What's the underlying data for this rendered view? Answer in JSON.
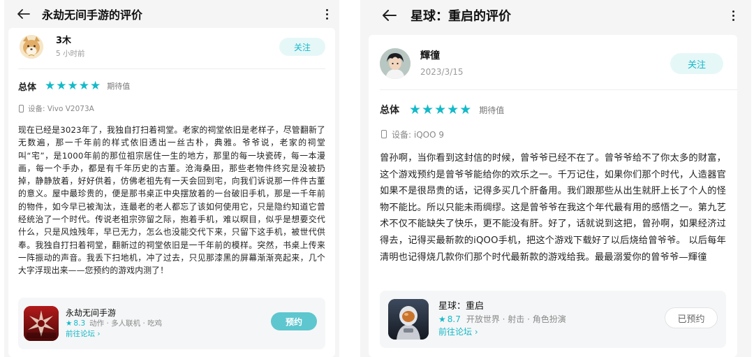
{
  "accent_color": "#14b9c8",
  "left": {
    "title": "永劫无间手游的评价",
    "user": {
      "name": "3木",
      "time": "5 小时前"
    },
    "follow_label": "关注",
    "rating": {
      "label": "总体",
      "stars": 5,
      "tag": "期待值"
    },
    "device": "设备:  Vivo V2073A",
    "review": "现在已经是3023年了，我独自打扫着祠堂。老家的祠堂依旧是老样子，尽管翻新了无数遍，那一千年前的样式依旧透出一丝古朴，典雅。爷爷说，老家的祠堂叫“宅”，是1000年前的那位祖宗居住一生的地方，那里的每一块瓷砖，每一本漫画，每一个手办，都是有千年历史的古董。沧海桑田，那些老物件终究是没被扔掉，静静放着，好好供着，仿佛老祖先有一天会回到宅，向我们诉说那一件件古董的意义。屋中最珍贵的，便是那书桌正中央摆放着的一台破旧手机，那是一千年前的物件，如今早已被淘汰，连最老的老人都忘了该如何使用它，只是隐约知道它曾经统治了一个时代。传说老祖宗弥留之际，抱着手机，难以瞑目，似乎是想要交代什么，只是风烛残年，早已无力，怎么也没能交代下来，只留下这手机，被世代供奉。我独自打扫着祠堂，翻新过的祠堂依旧是一千年前的模样。突然，书桌上传来一阵振动的声音。我丢下扫地机，冲了过去，只见那漆黑的屏幕渐渐亮起来，几个大字浮现出来——您预约的游戏内测了！",
    "game": {
      "name": "永劫无间手游",
      "score": "8.3",
      "tags": "动作 · 多人联机 · 吃鸡",
      "forum": "前往论坛 ›",
      "action": "预约",
      "icon_name": "naraka-game-icon"
    }
  },
  "right": {
    "title": "星球：重启的评价",
    "user": {
      "name": "輝徸",
      "time": "2023/3/15"
    },
    "follow_label": "关注",
    "rating": {
      "label": "总体",
      "stars": 5,
      "tag": "期待值"
    },
    "device": "设备:  iQOO 9",
    "review": "曾孙啊，当你看到这封信的时候，曾爷爷已经不在了。曾爷爷给不了你太多的财富，这个游戏预约是曾爷爷能给你的欢乐之一。千万记住，如果你们那个时代，人造器官如果不是很昂贵的话，记得多买几个肝备用。我们跟那些从出生就肝上长了个人的怪物不能比。所以只能未雨绸缪。这是曾爷爷在我这个年代最有用的感悟之一。第九艺术不仅不能缺失了快乐，更不能没有肝。好了，话就说到这把，曾孙啊，如果经济过得去，记得买最新款的iQOO手机，把这个游戏下载好了以后烧给曾爷爷。 以后每年清明也记得烧几款你们那个时代最新款的游戏给我。最最溺爱你的曾爷爷—輝徸",
    "game": {
      "name": "星球：重启",
      "score": "8.7",
      "tags": "开放世界 · 射击 · 角色扮演",
      "forum": "前往论坛 ›",
      "action": "已预约",
      "icon_name": "astronaut-game-icon"
    }
  }
}
